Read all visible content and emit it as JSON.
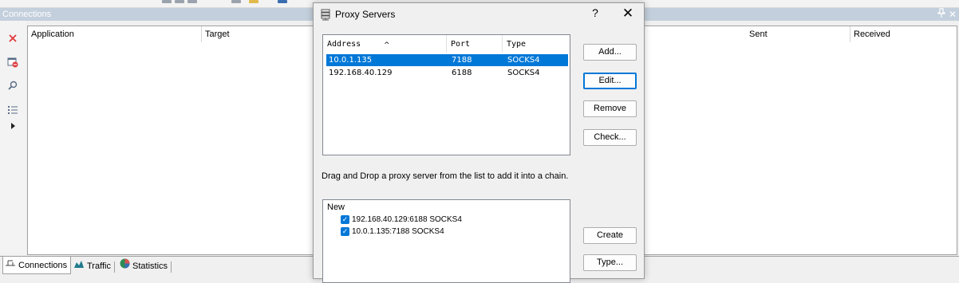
{
  "pane": {
    "title": "Connections"
  },
  "table": {
    "columns": [
      "Application",
      "Target",
      "Sent",
      "Received"
    ]
  },
  "side_toolbar": [
    "close-icon",
    "remove-connection-icon",
    "search-icon",
    "list-icon",
    "play-icon"
  ],
  "bottom_tabs": [
    {
      "label": "Connections",
      "icon": "connections-icon",
      "active": true
    },
    {
      "label": "Traffic",
      "icon": "traffic-icon",
      "active": false
    },
    {
      "label": "Statistics",
      "icon": "statistics-icon",
      "active": false
    }
  ],
  "dialog": {
    "title": "Proxy Servers",
    "help": "?",
    "close": "✕",
    "list_headers": {
      "address": "Address",
      "port": "Port",
      "type": "Type"
    },
    "rows": [
      {
        "address": "10.0.1.135",
        "port": "7188",
        "type": "SOCKS4",
        "selected": true
      },
      {
        "address": "192.168.40.129",
        "port": "6188",
        "type": "SOCKS4",
        "selected": false
      }
    ],
    "buttons": {
      "add": "Add...",
      "edit": "Edit...",
      "remove": "Remove",
      "check": "Check...",
      "create": "Create",
      "type": "Type..."
    },
    "hint": "Drag and Drop a proxy server from the list to add it into a chain.",
    "chain": {
      "root": "New",
      "items": [
        {
          "label": "192.168.40.129:6188 SOCKS4",
          "checked": true
        },
        {
          "label": "10.0.1.135:7188 SOCKS4",
          "checked": true
        }
      ]
    }
  },
  "colors": {
    "selection": "#0078d7",
    "header_bg": "#c3cfdc"
  }
}
